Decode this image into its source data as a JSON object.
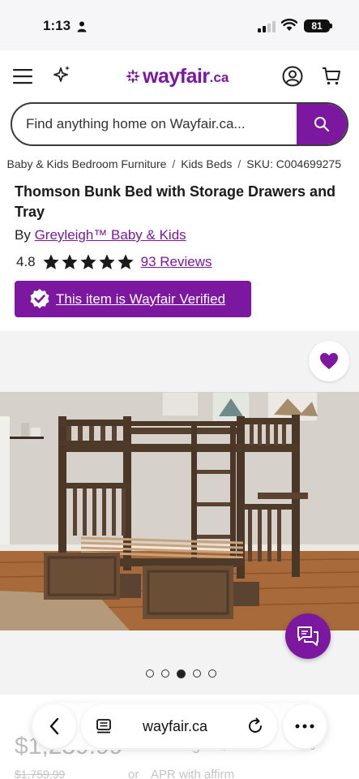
{
  "status_bar": {
    "time": "1:13",
    "battery": "81"
  },
  "header": {
    "logo_text": "wayfair",
    "logo_tld": ".ca"
  },
  "search": {
    "placeholder": "Find anything home on Wayfair.ca..."
  },
  "breadcrumb": {
    "items": [
      "Baby & Kids Bedroom Furniture",
      "Kids Beds"
    ],
    "sku": "SKU: C004699275"
  },
  "product": {
    "title": "Thomson Bunk Bed with Storage Drawers and Tray",
    "by_prefix": "By",
    "brand": "Greyleigh™ Baby & Kids",
    "rating": "4.8",
    "stars": 5,
    "reviews": "93 Reviews",
    "verified": "This item is Wayfair Verified"
  },
  "gallery": {
    "image_count": 5,
    "active_index": 2
  },
  "pricing": {
    "price": "$1,239.99",
    "old_price": "$1,759.99",
    "starting": "Starting at $67/mo. or 0%",
    "or": "or",
    "apr": "APR with affirm"
  },
  "browser": {
    "url": "wayfair.ca"
  },
  "colors": {
    "brand_purple": "#7b189f"
  }
}
